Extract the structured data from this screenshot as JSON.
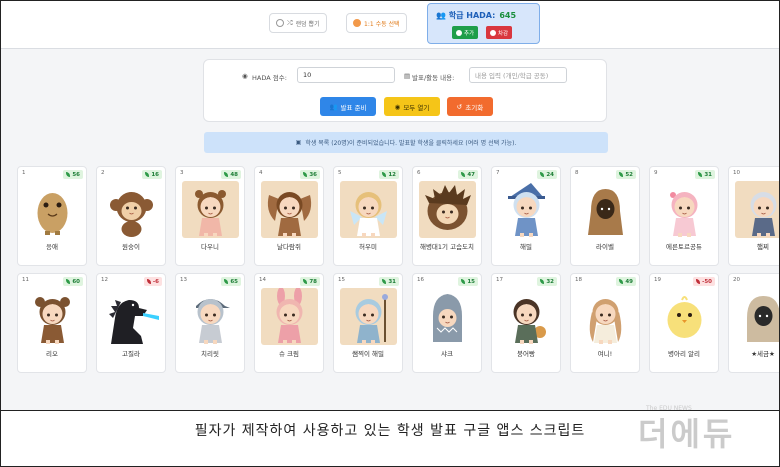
{
  "toolbar": {
    "random_label": "랜덤 뽑기",
    "manual_label": "1:1 수동 선택"
  },
  "hada": {
    "title": "학급 HADA:",
    "value": "645",
    "add_label": "추가",
    "sub_label": "차감"
  },
  "panel": {
    "points_label": "HADA 점수:",
    "points_value": "10",
    "content_label": "발표/활동 내용:",
    "content_placeholder": "내용 입력 (개인/학급 공동)",
    "ready_button": "발표 준비",
    "open_all_button": "모두 열기",
    "reset_button": "초기화"
  },
  "notice": "학생 목록 (20명)이 준비되었습니다. 발표할 학생을 클릭하세요 (여러 명 선택 가능).",
  "students": [
    {
      "no": "1",
      "name": "응애",
      "score": "56",
      "bg": "white",
      "char": "potato"
    },
    {
      "no": "2",
      "name": "원숭이",
      "score": "16",
      "bg": "white",
      "char": "monkey"
    },
    {
      "no": "3",
      "name": "다우니",
      "score": "48",
      "bg": "tan",
      "char": "bear-girl"
    },
    {
      "no": "4",
      "name": "날다람쥐",
      "score": "36",
      "bg": "tan",
      "char": "squirrel-girl"
    },
    {
      "no": "5",
      "name": "허우미",
      "score": "12",
      "bg": "tan",
      "char": "fairy"
    },
    {
      "no": "6",
      "name": "해병대1기 고슴도치",
      "score": "47",
      "bg": "tan",
      "char": "hedgehog"
    },
    {
      "no": "7",
      "name": "해밀",
      "score": "24",
      "bg": "white",
      "char": "witch"
    },
    {
      "no": "8",
      "name": "라이벨",
      "score": "52",
      "bg": "white",
      "char": "hood"
    },
    {
      "no": "9",
      "name": "에른토르공듀",
      "score": "31",
      "bg": "white",
      "char": "pink-girl"
    },
    {
      "no": "10",
      "name": "햄찌",
      "score": "",
      "bg": "tan",
      "char": "silver-girl"
    },
    {
      "no": "11",
      "name": "리오",
      "score": "60",
      "bg": "white",
      "char": "bear-kid"
    },
    {
      "no": "12",
      "name": "고질라",
      "score": "-6",
      "bg": "white",
      "char": "godzilla"
    },
    {
      "no": "13",
      "name": "치리릿",
      "score": "65",
      "bg": "white",
      "char": "cap-kid"
    },
    {
      "no": "14",
      "name": "슈 크림",
      "score": "78",
      "bg": "tan",
      "char": "bunny"
    },
    {
      "no": "15",
      "name": "쌤찍이 해밀",
      "score": "31",
      "bg": "tan",
      "char": "mage"
    },
    {
      "no": "16",
      "name": "샤크",
      "score": "15",
      "bg": "white",
      "char": "shark"
    },
    {
      "no": "17",
      "name": "붕어빵",
      "score": "32",
      "bg": "white",
      "char": "boy"
    },
    {
      "no": "18",
      "name": "여니!",
      "score": "49",
      "bg": "white",
      "char": "long-hair"
    },
    {
      "no": "19",
      "name": "병아리 알리",
      "score": "-50",
      "bg": "white",
      "char": "chick"
    },
    {
      "no": "20",
      "name": "★세금★",
      "score": "",
      "bg": "white",
      "char": "hood-dark"
    }
  ],
  "caption": "필자가 제작하여 사용하고 있는 학생 발표 구글 앱스 스크립트",
  "watermark": "더에듀",
  "watermark_small": "The EDU NEWS"
}
